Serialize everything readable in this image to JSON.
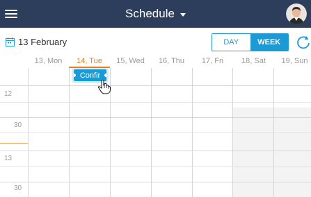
{
  "header": {
    "title": "Schedule",
    "menu_icon": "hamburger-menu-icon",
    "avatar_icon": "user-avatar"
  },
  "toolbar": {
    "date_label": "13 February",
    "view_day": "DAY",
    "view_week": "WEEK",
    "active_view": "WEEK"
  },
  "days": [
    {
      "label": "13, Mon",
      "active": false
    },
    {
      "label": "14, Tue",
      "active": true
    },
    {
      "label": "15, Wed",
      "active": false
    },
    {
      "label": "16, Thu",
      "active": false
    },
    {
      "label": "17, Fri",
      "active": false
    },
    {
      "label": "18, Sat",
      "active": false
    },
    {
      "label": "19, Sun",
      "active": false
    }
  ],
  "times": [
    "12",
    "30",
    "13",
    "30"
  ],
  "event": {
    "label": "Confir"
  },
  "colors": {
    "header_bg": "#2c3e5c",
    "accent": "#1c9ad6",
    "today": "#f07f1e"
  }
}
